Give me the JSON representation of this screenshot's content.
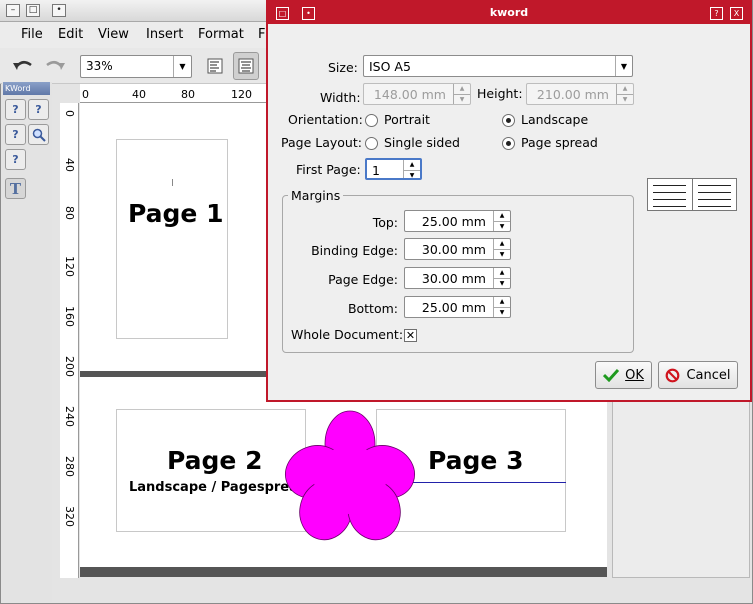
{
  "menubar": {
    "file": "File",
    "edit": "Edit",
    "view": "View",
    "insert": "Insert",
    "format": "Format",
    "more": "F"
  },
  "toolbar": {
    "zoom": "33%"
  },
  "toolbox": {
    "title": "KWord"
  },
  "ruler_h": [
    "0",
    "40",
    "80",
    "120"
  ],
  "ruler_v": [
    "0",
    "40",
    "80",
    "120",
    "160",
    "200",
    "240",
    "280",
    "320"
  ],
  "canvas": {
    "page1": "Page 1",
    "page2": "Page 2",
    "page2_sub": "Landscape / Pagespread",
    "page3": "Page 3"
  },
  "dialog": {
    "title": "kword",
    "size_label": "Size:",
    "size_value": "ISO A5",
    "width_label": "Width:",
    "width_value": "148.00 mm",
    "height_label": "Height:",
    "height_value": "210.00 mm",
    "orientation_label": "Orientation:",
    "portrait": "Portrait",
    "landscape": "Landscape",
    "page_layout_label": "Page Layout:",
    "single_sided": "Single sided",
    "page_spread": "Page spread",
    "first_page_label": "First Page:",
    "first_page_value": "1",
    "margins_title": "Margins",
    "top_label": "Top:",
    "top_value": "25.00 mm",
    "binding_label": "Binding Edge:",
    "binding_value": "30.00 mm",
    "page_edge_label": "Page Edge:",
    "page_edge_value": "30.00 mm",
    "bottom_label": "Bottom:",
    "bottom_value": "25.00 mm",
    "whole_doc_label": "Whole Document:",
    "ok": "OK",
    "cancel": "Cancel",
    "help": "?",
    "close": "X"
  },
  "colors": {
    "dialog_accent": "#c0182a",
    "shape_fill": "#ff00ff",
    "ok_check": "#1f9a1f",
    "cancel_icon": "#d0141e"
  }
}
